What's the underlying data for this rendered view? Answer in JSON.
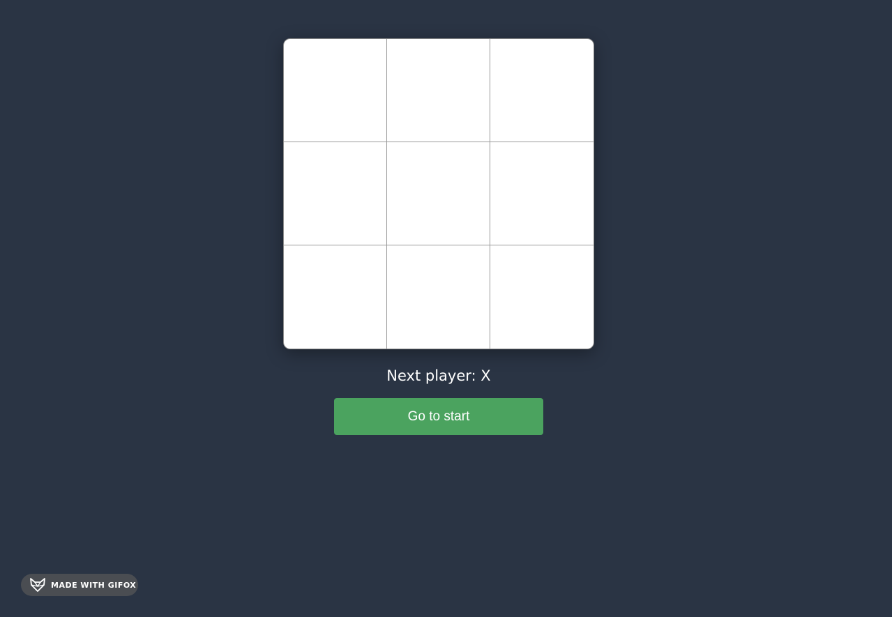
{
  "board": {
    "cells": [
      "",
      "",
      "",
      "",
      "",
      "",
      "",
      "",
      ""
    ]
  },
  "status": {
    "text": "Next player: X"
  },
  "controls": {
    "go_to_start_label": "Go to start"
  },
  "badge": {
    "label": "MADE WITH GIFOX",
    "icon": "fox-icon"
  },
  "colors": {
    "background": "#2a3444",
    "board": "#ffffff",
    "button": "#4ba35f",
    "badge": "#4a4d52"
  }
}
